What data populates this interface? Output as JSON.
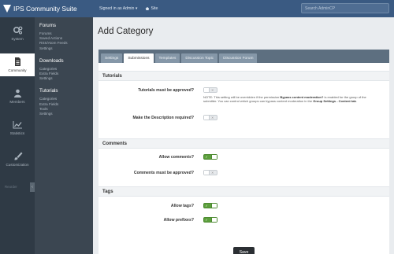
{
  "header": {
    "app_title": "IPS Community Suite",
    "signed_in": "Signed in as Admin ▾",
    "site_label": "Site",
    "search_placeholder": "Search AdminCP"
  },
  "nav": {
    "items": [
      {
        "label": "System",
        "icon": "gears-icon"
      },
      {
        "label": "Community",
        "icon": "document-icon",
        "active": true
      },
      {
        "label": "Members",
        "icon": "users-icon"
      },
      {
        "label": "Statistics",
        "icon": "chart-icon"
      },
      {
        "label": "Customization",
        "icon": "brush-icon"
      }
    ],
    "collapse_label": "Reorder"
  },
  "subnav": {
    "groups": [
      {
        "title": "Forums",
        "links": [
          "Forums",
          "Saved Actions",
          "RSS/Atom Feeds",
          "Settings"
        ]
      },
      {
        "title": "Downloads",
        "links": [
          "Categories",
          "Extra Fields",
          "Settings"
        ]
      },
      {
        "title": "Tutorials",
        "links": [
          "Categories",
          "Extra Fields",
          "Tools",
          "Settings"
        ]
      }
    ]
  },
  "page": {
    "title": "Add Category",
    "tabs": [
      "Settings",
      "Submissions",
      "Templates",
      "Discussion Topic",
      "Discussion Forum"
    ],
    "active_tab": "Submissions",
    "sections": {
      "tutorials": {
        "title": "Tutorials",
        "approve_label": "Tutorials must be approved?",
        "note_prefix": "NOTE: This setting will be overridden if the permission ",
        "note_bold": "Bypass content moderation?",
        "note_middle": " is enabled for the group of the submitter. You can control which groups can bypass content moderation in the ",
        "note_link": "Group Settings - Content tab",
        "note_end": ".",
        "description_label": "Make the Description required?"
      },
      "comments": {
        "title": "Comments",
        "allow_label": "Allow comments?",
        "approve_label": "Comments must be approved?"
      },
      "tags": {
        "title": "Tags",
        "allow_label": "Allow tags?",
        "prefixes_label": "Allow prefixes?"
      }
    },
    "toggles": {
      "tutorials_approve": false,
      "description_required": false,
      "allow_comments": true,
      "comments_approve": false,
      "allow_tags": true,
      "allow_prefixes": true
    },
    "save_label": "Save"
  },
  "colors": {
    "topbar": "#3a5a82",
    "nav": "#2f3a45",
    "subnav": "#3b4651",
    "toggle_on": "#5c9f3c"
  }
}
